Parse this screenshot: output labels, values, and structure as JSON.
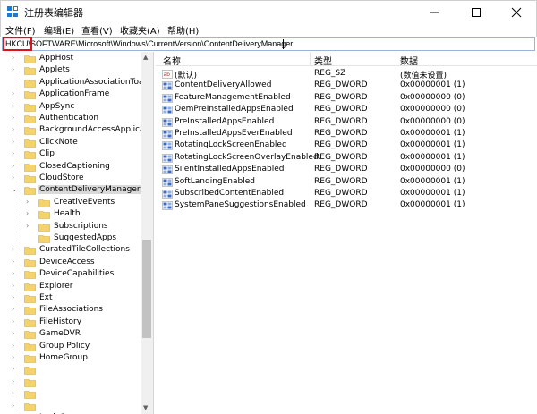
{
  "window": {
    "title": "注册表编辑器"
  },
  "menu": [
    {
      "label": "文件(F)"
    },
    {
      "label": "编辑(E)"
    },
    {
      "label": "查看(V)"
    },
    {
      "label": "收藏夹(A)"
    },
    {
      "label": "帮助(H)"
    }
  ],
  "address": {
    "prefix": "HKCU\\",
    "path": "SOFTWARE\\Microsoft\\Windows\\CurrentVersion\\ContentDeliveryManager"
  },
  "tree": {
    "items": [
      {
        "label": "AppHost",
        "level": 1,
        "expandable": true
      },
      {
        "label": "Applets",
        "level": 1,
        "expandable": true
      },
      {
        "label": "ApplicationAssociationToasts",
        "level": 1,
        "expandable": false
      },
      {
        "label": "ApplicationFrame",
        "level": 1,
        "expandable": true
      },
      {
        "label": "AppSync",
        "level": 1,
        "expandable": true
      },
      {
        "label": "Authentication",
        "level": 1,
        "expandable": true
      },
      {
        "label": "BackgroundAccessApplications",
        "level": 1,
        "expandable": true
      },
      {
        "label": "ClickNote",
        "level": 1,
        "expandable": true
      },
      {
        "label": "Clip",
        "level": 1,
        "expandable": true
      },
      {
        "label": "ClosedCaptioning",
        "level": 1,
        "expandable": true
      },
      {
        "label": "CloudStore",
        "level": 1,
        "expandable": true
      },
      {
        "label": "ContentDeliveryManager",
        "level": 1,
        "expandable": true,
        "expanded": true,
        "selected": true
      },
      {
        "label": "CreativeEvents",
        "level": 2,
        "expandable": true
      },
      {
        "label": "Health",
        "level": 2,
        "expandable": true
      },
      {
        "label": "Subscriptions",
        "level": 2,
        "expandable": true
      },
      {
        "label": "SuggestedApps",
        "level": 2,
        "expandable": false
      },
      {
        "label": "CuratedTileCollections",
        "level": 1,
        "expandable": true
      },
      {
        "label": "DeviceAccess",
        "level": 1,
        "expandable": true
      },
      {
        "label": "DeviceCapabilities",
        "level": 1,
        "expandable": true
      },
      {
        "label": "Explorer",
        "level": 1,
        "expandable": true
      },
      {
        "label": "Ext",
        "level": 1,
        "expandable": true
      },
      {
        "label": "FileAssociations",
        "level": 1,
        "expandable": true
      },
      {
        "label": "FileHistory",
        "level": 1,
        "expandable": true
      },
      {
        "label": "GameDVR",
        "level": 1,
        "expandable": true
      },
      {
        "label": "Group Policy",
        "level": 1,
        "expandable": true
      },
      {
        "label": "HomeGroup",
        "level": 1,
        "expandable": true
      },
      {
        "label": "",
        "level": 1,
        "expandable": true
      },
      {
        "label": "",
        "level": 1,
        "expandable": true
      },
      {
        "label": "",
        "level": 1,
        "expandable": true
      },
      {
        "label": "",
        "level": 1,
        "expandable": true
      },
      {
        "label": "Lock Screen",
        "level": 1,
        "expandable": true
      }
    ]
  },
  "list": {
    "headers": {
      "name": "名称",
      "type": "类型",
      "data": "数据"
    },
    "rows": [
      {
        "icon": "string-icon",
        "name": "(默认)",
        "type": "REG_SZ",
        "data": "(数值未设置)"
      },
      {
        "icon": "binary-icon",
        "name": "ContentDeliveryAllowed",
        "type": "REG_DWORD",
        "data": "0x00000001 (1)"
      },
      {
        "icon": "binary-icon",
        "name": "FeatureManagementEnabled",
        "type": "REG_DWORD",
        "data": "0x00000000 (0)"
      },
      {
        "icon": "binary-icon",
        "name": "OemPreInstalledAppsEnabled",
        "type": "REG_DWORD",
        "data": "0x00000000 (0)"
      },
      {
        "icon": "binary-icon",
        "name": "PreInstalledAppsEnabled",
        "type": "REG_DWORD",
        "data": "0x00000000 (0)"
      },
      {
        "icon": "binary-icon",
        "name": "PreInstalledAppsEverEnabled",
        "type": "REG_DWORD",
        "data": "0x00000001 (1)"
      },
      {
        "icon": "binary-icon",
        "name": "RotatingLockScreenEnabled",
        "type": "REG_DWORD",
        "data": "0x00000001 (1)"
      },
      {
        "icon": "binary-icon",
        "name": "RotatingLockScreenOverlayEnabled",
        "type": "REG_DWORD",
        "data": "0x00000001 (1)"
      },
      {
        "icon": "binary-icon",
        "name": "SilentInstalledAppsEnabled",
        "type": "REG_DWORD",
        "data": "0x00000000 (0)"
      },
      {
        "icon": "binary-icon",
        "name": "SoftLandingEnabled",
        "type": "REG_DWORD",
        "data": "0x00000001 (1)"
      },
      {
        "icon": "binary-icon",
        "name": "SubscribedContentEnabled",
        "type": "REG_DWORD",
        "data": "0x00000001 (1)"
      },
      {
        "icon": "binary-icon",
        "name": "SystemPaneSuggestionsEnabled",
        "type": "REG_DWORD",
        "data": "0x00000001 (1)"
      }
    ]
  },
  "colors": {
    "highlight": "#e0101a",
    "folder": "#f4d36c",
    "selection": "#d9d9d9"
  }
}
